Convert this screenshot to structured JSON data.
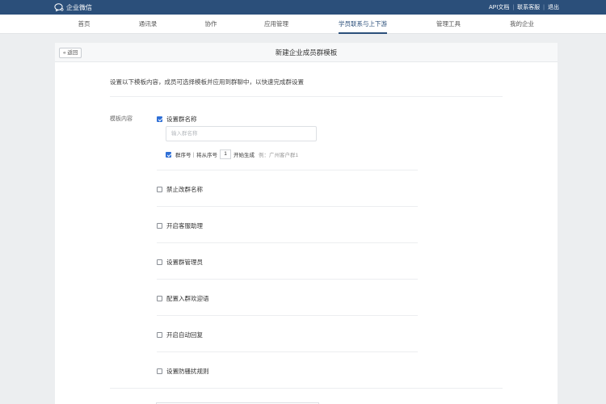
{
  "topbar": {
    "brand": "企业微信",
    "links": [
      "API文档",
      "联系客服",
      "退出"
    ]
  },
  "nav": {
    "items": [
      "首页",
      "通讯录",
      "协作",
      "应用管理",
      "学员联系与上下游",
      "管理工具",
      "我的企业"
    ],
    "active_index": 4
  },
  "page": {
    "back_label": "« 返回",
    "title": "新建企业成员群模板",
    "intro": "设置以下模板内容，成员可选择模板并应用到群聊中，以快速完成群设置",
    "field_label": "模板内容"
  },
  "group_name": {
    "label": "设置群名称",
    "checked": true,
    "input_placeholder": "输入群名称",
    "input_value": "",
    "serial_label": "群序号｜将从序号",
    "serial_start": "1",
    "serial_suffix": "开始生成",
    "serial_example": "例：广州客户群1",
    "serial_checked": true
  },
  "options": [
    {
      "label": "禁止改群名称",
      "checked": false
    },
    {
      "label": "开启客服助理",
      "checked": false
    },
    {
      "label": "设置群管理员",
      "checked": false
    },
    {
      "label": "配置入群欢迎语",
      "checked": false
    },
    {
      "label": "开启自动回复",
      "checked": false
    },
    {
      "label": "设置防骚扰规则",
      "checked": false
    }
  ],
  "colors": {
    "topbar": "#2b4f7a",
    "accent": "#2f6fd6",
    "background": "#eceef0"
  }
}
